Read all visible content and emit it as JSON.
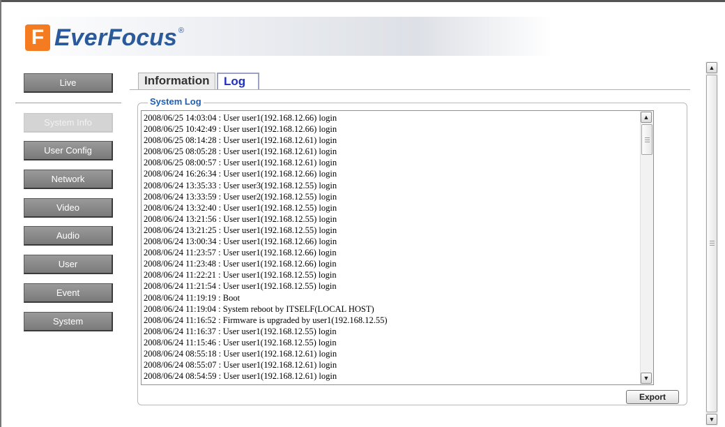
{
  "brand": {
    "mark": "F",
    "name_part1": "Ever",
    "name_part2": "Focus",
    "registered": "®"
  },
  "nav": {
    "live": "Live",
    "items": [
      {
        "label": "System Info",
        "disabled": true
      },
      {
        "label": "User Config",
        "disabled": false
      },
      {
        "label": "Network",
        "disabled": false
      },
      {
        "label": "Video",
        "disabled": false
      },
      {
        "label": "Audio",
        "disabled": false
      },
      {
        "label": "User",
        "disabled": false
      },
      {
        "label": "Event",
        "disabled": false
      },
      {
        "label": "System",
        "disabled": false
      }
    ]
  },
  "tabs": [
    {
      "label": "Information",
      "active": false
    },
    {
      "label": "Log",
      "active": true
    }
  ],
  "system_log": {
    "legend": "System Log",
    "lines": [
      "2008/06/25 14:03:04 : User user1(192.168.12.66) login",
      "2008/06/25 10:42:49 : User user1(192.168.12.66) login",
      "2008/06/25 08:14:28 : User user1(192.168.12.61) login",
      "2008/06/25 08:05:28 : User user1(192.168.12.61) login",
      "2008/06/25 08:00:57 : User user1(192.168.12.61) login",
      "2008/06/24 16:26:34 : User user1(192.168.12.66) login",
      "2008/06/24 13:35:33 : User user3(192.168.12.55) login",
      "2008/06/24 13:33:59 : User user2(192.168.12.55) login",
      "2008/06/24 13:32:40 : User user1(192.168.12.55) login",
      "2008/06/24 13:21:56 : User user1(192.168.12.55) login",
      "2008/06/24 13:21:25 : User user1(192.168.12.55) login",
      "2008/06/24 13:00:34 : User user1(192.168.12.66) login",
      "2008/06/24 11:23:57 : User user1(192.168.12.66) login",
      "2008/06/24 11:23:48 : User user1(192.168.12.66) login",
      "2008/06/24 11:22:21 : User user1(192.168.12.55) login",
      "2008/06/24 11:21:54 : User user1(192.168.12.55) login",
      "2008/06/24 11:19:19 : Boot",
      "2008/06/24 11:19:04 : System reboot by ITSELF(LOCAL HOST)",
      "2008/06/24 11:16:52 : Firmware is upgraded by user1(192.168.12.55)",
      "2008/06/24 11:16:37 : User user1(192.168.12.55) login",
      "2008/06/24 11:15:46 : User user1(192.168.12.55) login",
      "2008/06/24 08:55:18 : User user1(192.168.12.61) login",
      "2008/06/24 08:55:07 : User user1(192.168.12.61) login",
      "2008/06/24 08:54:59 : User user1(192.168.12.61) login"
    ],
    "export_label": "Export"
  },
  "icons": {
    "scroll_up": "▲",
    "scroll_down": "▼"
  },
  "colors": {
    "brand_orange": "#f47b20",
    "brand_blue": "#2a5a9a",
    "legend_blue": "#1f5fb0",
    "active_tab_text": "#1f30c0"
  }
}
